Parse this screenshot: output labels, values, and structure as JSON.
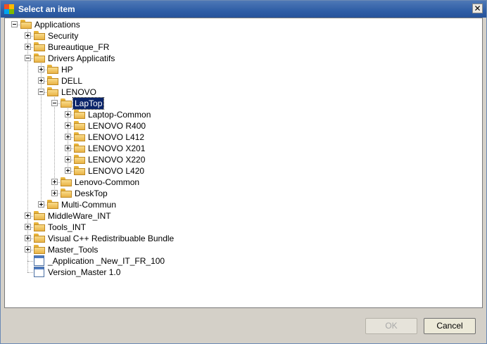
{
  "window": {
    "title": "Select an item",
    "close_glyph": "✕"
  },
  "tree": {
    "nodes": [
      {
        "label": "Applications",
        "level": 0,
        "expander": "minus",
        "icon": "folder",
        "selected": false
      },
      {
        "label": "Security",
        "level": 1,
        "expander": "plus",
        "icon": "folder",
        "selected": false
      },
      {
        "label": "Bureautique_FR",
        "level": 1,
        "expander": "plus",
        "icon": "folder",
        "selected": false
      },
      {
        "label": "Drivers Applicatifs",
        "level": 1,
        "expander": "minus",
        "icon": "folder",
        "selected": false
      },
      {
        "label": "HP",
        "level": 2,
        "expander": "plus",
        "icon": "folder",
        "selected": false
      },
      {
        "label": "DELL",
        "level": 2,
        "expander": "plus",
        "icon": "folder",
        "selected": false
      },
      {
        "label": "LENOVO",
        "level": 2,
        "expander": "minus",
        "icon": "folder",
        "selected": false
      },
      {
        "label": "LapTop",
        "level": 3,
        "expander": "minus",
        "icon": "folder",
        "selected": true
      },
      {
        "label": "Laptop-Common",
        "level": 4,
        "expander": "plus",
        "icon": "folder",
        "selected": false
      },
      {
        "label": "LENOVO R400",
        "level": 4,
        "expander": "plus",
        "icon": "folder",
        "selected": false
      },
      {
        "label": "LENOVO L412",
        "level": 4,
        "expander": "plus",
        "icon": "folder",
        "selected": false
      },
      {
        "label": "LENOVO X201",
        "level": 4,
        "expander": "plus",
        "icon": "folder",
        "selected": false
      },
      {
        "label": "LENOVO X220",
        "level": 4,
        "expander": "plus",
        "icon": "folder",
        "selected": false
      },
      {
        "label": "LENOVO L420",
        "level": 4,
        "expander": "plus",
        "icon": "folder",
        "selected": false
      },
      {
        "label": "Lenovo-Common",
        "level": 3,
        "expander": "plus",
        "icon": "folder",
        "selected": false
      },
      {
        "label": "DeskTop",
        "level": 3,
        "expander": "plus",
        "icon": "folder",
        "selected": false
      },
      {
        "label": "Multi-Commun",
        "level": 2,
        "expander": "plus",
        "icon": "folder",
        "selected": false
      },
      {
        "label": "MiddleWare_INT",
        "level": 1,
        "expander": "plus",
        "icon": "folder",
        "selected": false
      },
      {
        "label": "Tools_INT",
        "level": 1,
        "expander": "plus",
        "icon": "folder",
        "selected": false
      },
      {
        "label": "Visual C++ Redistribuable Bundle",
        "level": 1,
        "expander": "plus",
        "icon": "folder",
        "selected": false
      },
      {
        "label": "Master_Tools",
        "level": 1,
        "expander": "plus",
        "icon": "folder",
        "selected": false
      },
      {
        "label": "_Application _New_IT_FR_100",
        "level": 1,
        "expander": "none",
        "icon": "file",
        "selected": false
      },
      {
        "label": "Version_Master 1.0",
        "level": 1,
        "expander": "none",
        "icon": "file",
        "selected": false
      }
    ]
  },
  "buttons": {
    "ok_label": "OK",
    "ok_enabled": false,
    "cancel_label": "Cancel"
  },
  "colors": {
    "selection": "#0a246a",
    "titlebar": "#2f5ea6",
    "dialog_bg": "#d4d0c8"
  }
}
